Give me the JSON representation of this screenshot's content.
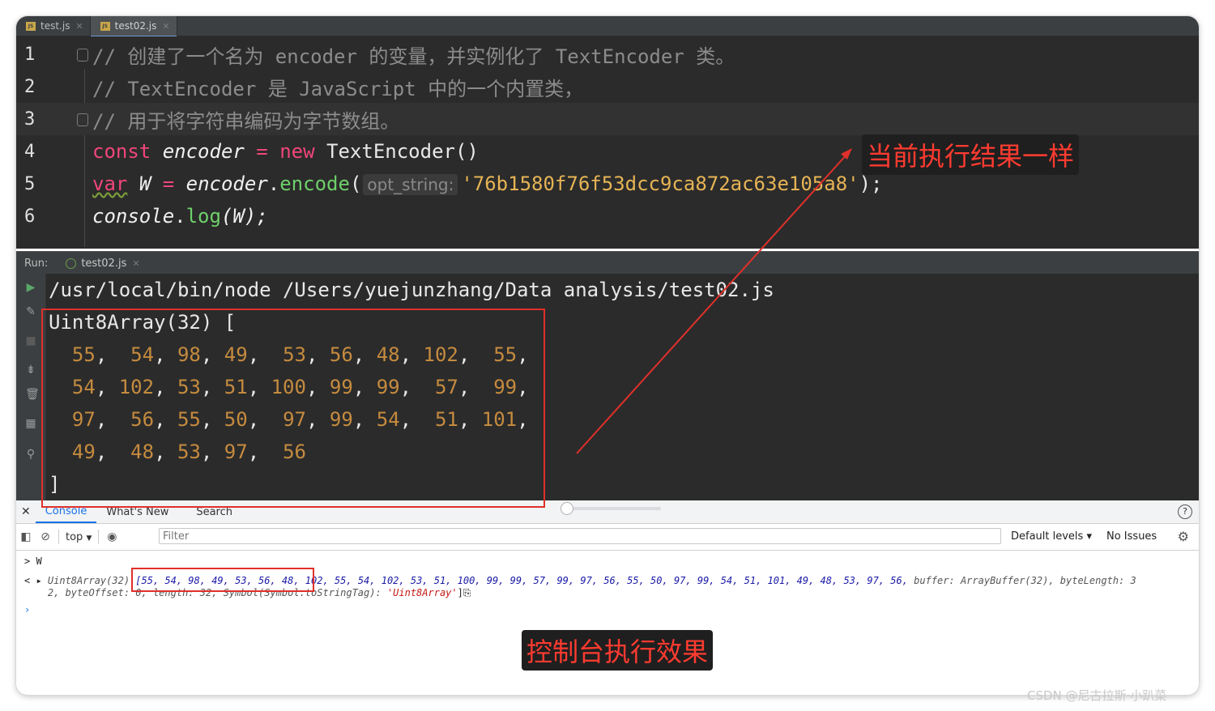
{
  "editor_tabs": [
    {
      "label": "test.js"
    },
    {
      "label": "test02.js"
    }
  ],
  "code_lines": [
    {
      "num": "1",
      "text": "// 创建了一个名为 encoder 的变量，并实例化了 TextEncoder 类。"
    },
    {
      "num": "2",
      "text": "// TextEncoder 是 JavaScript 中的一个内置类，"
    },
    {
      "num": "3",
      "text": "// 用于将字符串编码为字节数组。"
    },
    {
      "num": "4",
      "kw": "const",
      "var": "encoder",
      "op": " = ",
      "kw2": "new",
      "rest": " TextEncoder()"
    },
    {
      "num": "5",
      "kw": "var",
      "var": "W",
      "op": " = ",
      "obj": "encoder",
      "dot": ".",
      "fn": "encode",
      "paren": "(",
      "hint": "opt_string:",
      "str": "'76b1580f76f53dcc9ca872ac63e105a8'",
      "end": ");"
    },
    {
      "num": "6",
      "obj": "console",
      "dot": ".",
      "fn": "log",
      "args": "(W);"
    }
  ],
  "run_panel": {
    "label": "Run:",
    "tab": "test02.js",
    "command": "/usr/local/bin/node /Users/yuejunzhang/Data analysis/test02.js",
    "header": "Uint8Array(32) [",
    "rows": [
      [
        "55",
        "54",
        "98",
        "49",
        "53",
        "56",
        "48",
        "102",
        "55"
      ],
      [
        "54",
        "102",
        "53",
        "51",
        "100",
        "99",
        "99",
        "57",
        "99"
      ],
      [
        "97",
        "56",
        "55",
        "50",
        "97",
        "99",
        "54",
        "51",
        "101"
      ],
      [
        "49",
        "48",
        "53",
        "97",
        "56"
      ]
    ],
    "footer": "]"
  },
  "console": {
    "tabs": [
      "Console",
      "What's New",
      "Search"
    ],
    "context": "top",
    "filter_placeholder": "Filter",
    "levels": "Default levels ▾",
    "issues": "No Issues",
    "input_line": "W",
    "result_prefix": "Uint8Array(32) ",
    "result_values": "[55, 54, 98, 49, 53, 56, 48, 102, 55, 54, 102, 53, 51, 100, 99, 99, 57, 99, 97, 56, 55, 50, 97, 99, 54, 51, 101, 49, 48, 53, 97, 56,",
    "result_tail": " buffer: ArrayBuffer(32), byteLength: 3",
    "result_line2_a": "2, byteOffset: 0, length: 32, Symbol(Symbol.toStringTag): ",
    "result_line2_str": "'Uint8Array'",
    "result_line2_end": "]"
  },
  "annotations": {
    "top_label": "当前执行结果一样",
    "bottom_label": "控制台执行效果"
  },
  "watermark": "CSDN @尼古拉斯·小趴菜"
}
